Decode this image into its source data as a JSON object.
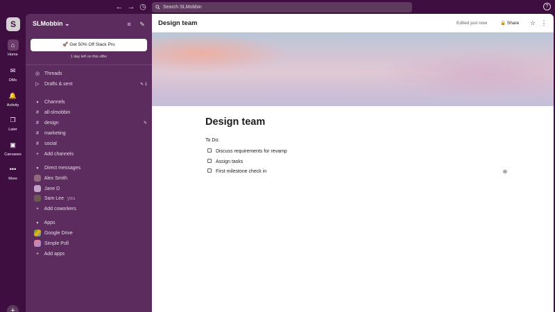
{
  "topbar": {
    "back_icon": "←",
    "forward_icon": "→",
    "history_icon": "◷",
    "search_placeholder": "Search SLMobbin",
    "help_icon": "?"
  },
  "rail": {
    "workspace_initial": "S",
    "items": [
      {
        "icon": "home-icon",
        "glyph": "⌂",
        "label": "Home"
      },
      {
        "icon": "dms-icon",
        "glyph": "✉",
        "label": "DMs"
      },
      {
        "icon": "bell-icon",
        "glyph": "🔔",
        "label": "Activity"
      },
      {
        "icon": "bookmark-icon",
        "glyph": "❒",
        "label": "Later"
      },
      {
        "icon": "canvas-icon",
        "glyph": "▣",
        "label": "Canvases"
      },
      {
        "icon": "more-icon",
        "glyph": "•••",
        "label": "More"
      }
    ],
    "add_glyph": "+"
  },
  "sidebar": {
    "workspace_name": "SLMobbin ⌄",
    "filter_icon": "≡",
    "compose_icon": "✎",
    "promo_label": "🚀 Get 50% Off Slack Pro",
    "promo_sub": "1 day left on this offer",
    "threads": "Threads",
    "drafts": "Drafts & sent",
    "drafts_count": "✎ 1",
    "channels_header": "Channels",
    "channels": [
      "all-slmobbin",
      "design",
      "marketing",
      "social"
    ],
    "add_channels": "Add channels",
    "dm_header": "Direct messages",
    "dms": [
      {
        "name": "Alex Smith",
        "color": "#8f6a7a"
      },
      {
        "name": "Jane D",
        "color": "#c4a3c9"
      },
      {
        "name": "Sam Lee",
        "color": "#6a5a52"
      }
    ],
    "you_label": "you",
    "add_coworkers": "Add coworkers",
    "apps_header": "Apps",
    "apps": [
      {
        "name": "Google Drive",
        "color": "#f4b400"
      },
      {
        "name": "Simple Poll",
        "color": "#f08080"
      }
    ],
    "add_apps": "Add apps"
  },
  "main": {
    "title": "Design team",
    "edited": "Edited just now",
    "share": "🔒 Share",
    "star_icon": "☆",
    "more_icon": "⋮",
    "doc_title": "Design team",
    "todo_label": "To Do:",
    "todos": [
      {
        "text": "Discuss requirements for revamp",
        "checked": false
      },
      {
        "text": "Assign tasks",
        "checked": false
      },
      {
        "text": "First milestone check in",
        "checked": false
      }
    ],
    "add_comment_icon": "⊕"
  },
  "colors": {
    "aubergine": "#3f0e40",
    "sidebar": "#5b2c5d"
  }
}
